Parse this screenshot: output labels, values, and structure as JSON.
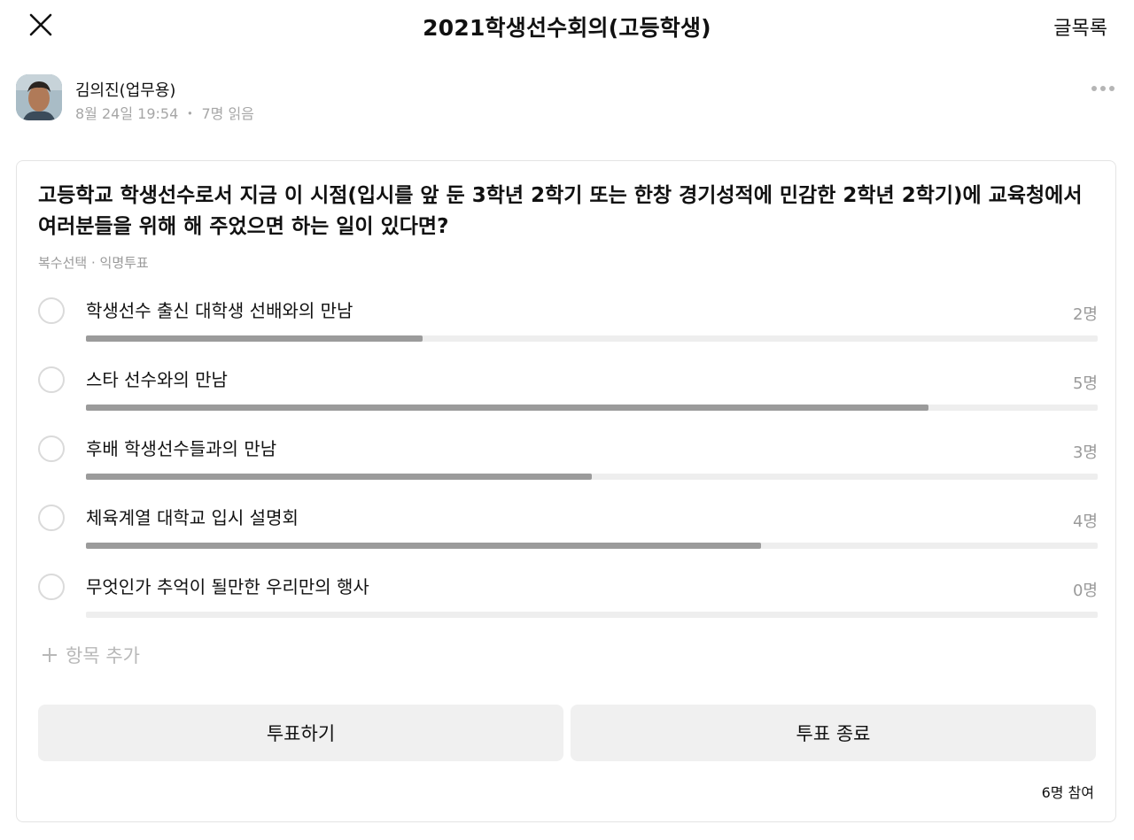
{
  "header": {
    "title": "2021학생선수회의(고등학생)",
    "list_label": "글목록"
  },
  "post": {
    "author": "김의진(업무용)",
    "date": "8월 24일 19:54",
    "reads": "7명 읽음"
  },
  "poll": {
    "question": "고등학교 학생선수로서 지금 이 시점(입시를 앞 둔 3학년 2학기 또는 한창 경기성적에 민감한 2학년 2학기)에 교육청에서 여러분들을 위해 해 주었으면 하는 일이 있다면?",
    "type_label": "복수선택",
    "anonymous_label": "익명투표",
    "options": [
      {
        "label": "학생선수 출신 대학생 선배와의 만남",
        "count": "2명",
        "fraction": 0.333
      },
      {
        "label": "스타 선수와의 만남",
        "count": "5명",
        "fraction": 0.833
      },
      {
        "label": "후배 학생선수들과의 만남",
        "count": "3명",
        "fraction": 0.5
      },
      {
        "label": "체육계열 대학교 입시 설명회",
        "count": "4명",
        "fraction": 0.667
      },
      {
        "label": "무엇인가 추억이 될만한 우리만의 행사",
        "count": "0명",
        "fraction": 0
      }
    ],
    "add_item_label": "항목 추가",
    "vote_button": "투표하기",
    "end_button": "투표 종료",
    "participants": "6명 참여"
  },
  "colors": {
    "bar_fill": "#9b9b9b",
    "bar_track": "#eeeeee",
    "button_bg": "#f0f0f0"
  }
}
